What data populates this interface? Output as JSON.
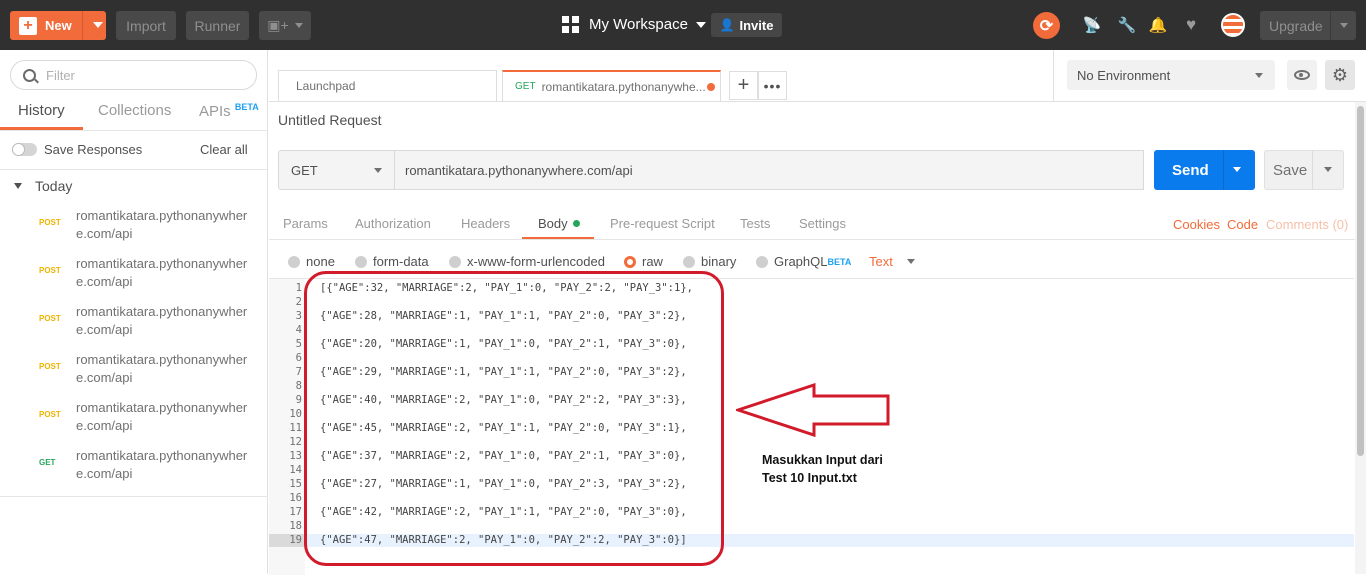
{
  "topbar": {
    "new_label": "New",
    "import_label": "Import",
    "runner_label": "Runner",
    "workspace_label": "My Workspace",
    "invite_label": "Invite",
    "upgrade_label": "Upgrade"
  },
  "sidebar": {
    "filter_placeholder": "Filter",
    "tabs": [
      "History",
      "Collections",
      "APIs"
    ],
    "apis_badge": "BETA",
    "save_responses_label": "Save Responses",
    "clear_all_label": "Clear all",
    "group_label": "Today",
    "history": [
      {
        "method": "POST",
        "url": "romantikatara.pythonanywhere.com/api"
      },
      {
        "method": "POST",
        "url": "romantikatara.pythonanywhere.com/api"
      },
      {
        "method": "POST",
        "url": "romantikatara.pythonanywhere.com/api"
      },
      {
        "method": "POST",
        "url": "romantikatara.pythonanywhere.com/api"
      },
      {
        "method": "POST",
        "url": "romantikatara.pythonanywhere.com/api"
      },
      {
        "method": "GET",
        "url": "romantikatara.pythonanywhere.com/api"
      }
    ]
  },
  "tabs": {
    "launchpad_label": "Launchpad",
    "active_method": "GET",
    "active_label": "romantikatara.pythonanywhe..."
  },
  "environment": {
    "selected": "No Environment"
  },
  "request": {
    "title": "Untitled Request",
    "method": "GET",
    "url": "romantikatara.pythonanywhere.com/api",
    "send_label": "Send",
    "save_label": "Save",
    "tabs": [
      "Params",
      "Authorization",
      "Headers",
      "Body",
      "Pre-request Script",
      "Tests",
      "Settings"
    ],
    "links": [
      "Cookies",
      "Code",
      "Comments (0)"
    ],
    "body_types": [
      "none",
      "form-data",
      "x-www-form-urlencoded",
      "raw",
      "binary",
      "GraphQL"
    ],
    "graphql_badge": "BETA",
    "selected_body_type": "raw",
    "raw_format": "Text"
  },
  "editor": {
    "line_numbers": [
      "1",
      "2",
      "3",
      "4",
      "5",
      "6",
      "7",
      "8",
      "9",
      "10",
      "11",
      "12",
      "13",
      "14",
      "15",
      "16",
      "17",
      "18",
      "19"
    ],
    "lines": [
      "[{\"AGE\":32, \"MARRIAGE\":2, \"PAY_1\":0, \"PAY_2\":2, \"PAY_3\":1},",
      "",
      "{\"AGE\":28, \"MARRIAGE\":1, \"PAY_1\":1, \"PAY_2\":0, \"PAY_3\":2},",
      "",
      "{\"AGE\":20, \"MARRIAGE\":1, \"PAY_1\":0, \"PAY_2\":1, \"PAY_3\":0},",
      "",
      "{\"AGE\":29, \"MARRIAGE\":1, \"PAY_1\":1, \"PAY_2\":0, \"PAY_3\":2},",
      "",
      "{\"AGE\":40, \"MARRIAGE\":2, \"PAY_1\":0, \"PAY_2\":2, \"PAY_3\":3},",
      "",
      "{\"AGE\":45, \"MARRIAGE\":2, \"PAY_1\":1, \"PAY_2\":0, \"PAY_3\":1},",
      "",
      "{\"AGE\":37, \"MARRIAGE\":2, \"PAY_1\":0, \"PAY_2\":1, \"PAY_3\":0},",
      "",
      "{\"AGE\":27, \"MARRIAGE\":1, \"PAY_1\":0, \"PAY_2\":3, \"PAY_3\":2},",
      "",
      "{\"AGE\":42, \"MARRIAGE\":2, \"PAY_1\":1, \"PAY_2\":0, \"PAY_3\":0},",
      "",
      "{\"AGE\":47, \"MARRIAGE\":2, \"PAY_1\":0, \"PAY_2\":2, \"PAY_3\":0}]"
    ]
  },
  "annotation": {
    "line1": "Masukkan Input dari",
    "line2": "Test 10 Input.txt",
    "color": "#d11a2a"
  }
}
